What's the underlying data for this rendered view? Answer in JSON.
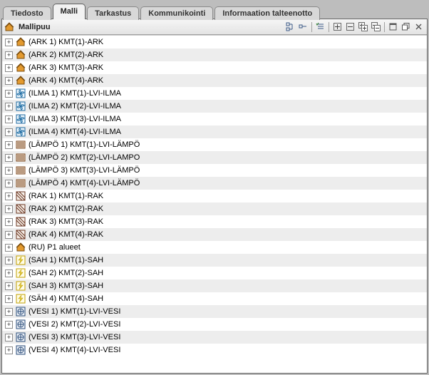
{
  "tabs": [
    {
      "label": "Tiedosto",
      "active": false
    },
    {
      "label": "Malli",
      "active": true
    },
    {
      "label": "Tarkastus",
      "active": false
    },
    {
      "label": "Kommunikointi",
      "active": false
    },
    {
      "label": "Informaation talteenotto",
      "active": false
    }
  ],
  "panel": {
    "title": "Mallipuu"
  },
  "toolbar": {
    "btn_expand_tree": "expand-tree",
    "btn_collapse_tree": "collapse-tree",
    "btn_checklist": "checklist",
    "btn_expand_node": "plus",
    "btn_collapse_node": "minus",
    "btn_expand_all": "plus-all",
    "btn_collapse_all": "minus-all",
    "btn_restore": "restore-window",
    "btn_detach": "detach",
    "btn_close": "close"
  },
  "icons": {
    "ark": "house",
    "ilma": "fan",
    "lampo": "radiator",
    "rak": "section",
    "ru": "house",
    "sah": "bolt",
    "vesi": "valve"
  },
  "colors": {
    "house_fill": "#e39a2f",
    "house_stroke": "#7a4d10",
    "fan_stroke": "#1f6aa0",
    "radiator_stroke": "#7d471c",
    "section_stroke": "#6b3520",
    "bolt_stroke": "#c2a000",
    "valve_stroke": "#274a78"
  },
  "tree": [
    {
      "icon": "ark",
      "label": "(ARK 1) KMT(1)-ARK"
    },
    {
      "icon": "ark",
      "label": "(ARK 2) KMT(2)-ARK"
    },
    {
      "icon": "ark",
      "label": "(ARK 3) KMT(3)-ARK"
    },
    {
      "icon": "ark",
      "label": "(ARK 4) KMT(4)-ARK"
    },
    {
      "icon": "ilma",
      "label": "(ILMA 1) KMT(1)-LVI-ILMA"
    },
    {
      "icon": "ilma",
      "label": "(ILMA 2) KMT(2)-LVI-ILMA"
    },
    {
      "icon": "ilma",
      "label": "(ILMA 3) KMT(3)-LVI-ILMA"
    },
    {
      "icon": "ilma",
      "label": "(ILMA 4) KMT(4)-LVI-ILMA"
    },
    {
      "icon": "lampo",
      "label": "(LÄMPÖ 1) KMT(1)-LVI-LÄMPÖ"
    },
    {
      "icon": "lampo",
      "label": "(LÄMPÖ 2) KMT(2)-LVI-LAMPO"
    },
    {
      "icon": "lampo",
      "label": "(LÄMPÖ 3) KMT(3)-LVI-LÄMPÖ"
    },
    {
      "icon": "lampo",
      "label": "(LÄMPÖ 4) KMT(4)-LVI-LÄMPÖ"
    },
    {
      "icon": "rak",
      "label": "(RAK 1) KMT(1)-RAK"
    },
    {
      "icon": "rak",
      "label": "(RAK 2) KMT(2)-RAK"
    },
    {
      "icon": "rak",
      "label": "(RAK 3) KMT(3)-RAK"
    },
    {
      "icon": "rak",
      "label": "(RAK 4) KMT(4)-RAK"
    },
    {
      "icon": "ru",
      "label": "(RU) P1 alueet"
    },
    {
      "icon": "sah",
      "label": "(SAH 1) KMT(1)-SAH"
    },
    {
      "icon": "sah",
      "label": "(SAH 2) KMT(2)-SAH"
    },
    {
      "icon": "sah",
      "label": "(SAH 3) KMT(3)-SAH"
    },
    {
      "icon": "sah",
      "label": "(SÄH 4) KMT(4)-SAH"
    },
    {
      "icon": "vesi",
      "label": "(VESI 1) KMT(1)-LVI-VESI"
    },
    {
      "icon": "vesi",
      "label": "(VESI 2) KMT(2)-LVI-VESI"
    },
    {
      "icon": "vesi",
      "label": "(VESI 3) KMT(3)-LVI-VESI"
    },
    {
      "icon": "vesi",
      "label": "(VESI 4) KMT(4)-LVI-VESI"
    }
  ]
}
